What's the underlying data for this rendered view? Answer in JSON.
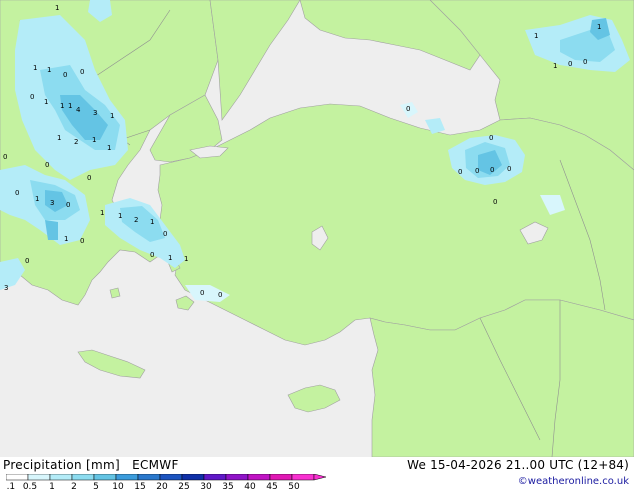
{
  "map": {
    "colors": {
      "sea": "#eeeeee",
      "land": "#c4f2a0",
      "coast": "#a0a0a0",
      "border": "#909090"
    },
    "precip_labels": [
      "1",
      "1",
      "1",
      "0",
      "0",
      "0",
      "1",
      "1",
      "1",
      "4",
      "3",
      "1",
      "1",
      "2",
      "1",
      "1",
      "0",
      "0",
      "0",
      "0",
      "1",
      "3",
      "0",
      "1",
      "1",
      "2",
      "1",
      "0",
      "1",
      "0",
      "0",
      "0",
      "0",
      "0",
      "1",
      "1",
      "3",
      "0",
      "0",
      "0",
      "0",
      "0",
      "0",
      "0",
      "1",
      "1",
      "1",
      "0",
      "0"
    ]
  },
  "legend": {
    "title": "Precipitation [mm]",
    "model": "ECMWF",
    "ticks": [
      "0.1",
      "0.5",
      "1",
      "2",
      "5",
      "10",
      "15",
      "20",
      "25",
      "30",
      "35",
      "40",
      "45",
      "50"
    ],
    "colors": [
      "#ffffff",
      "#d8f6fc",
      "#b4ecf8",
      "#8cdcf0",
      "#64c4e4",
      "#3c9cdc",
      "#2a78cc",
      "#1c54c0",
      "#1030a8",
      "#6018c8",
      "#9014c8",
      "#c014c4",
      "#e018b4",
      "#f830d0"
    ]
  },
  "datetime": "We 15-04-2026 21..00 UTC (12+84)",
  "copyright": "©weatheronline.co.uk"
}
